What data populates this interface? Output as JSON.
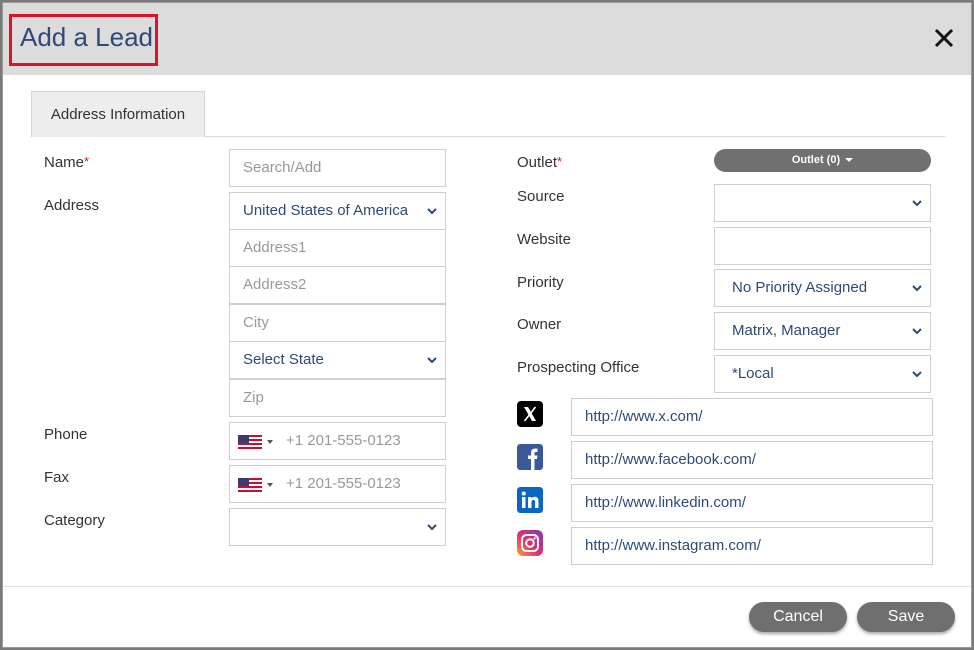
{
  "dialog": {
    "title": "Add a Lead",
    "close_label": "×"
  },
  "tabs": [
    {
      "label": "Address Information"
    }
  ],
  "left": {
    "name_label": "Name",
    "name_placeholder": "Search/Add",
    "address_label": "Address",
    "country_value": "United States of America",
    "address1_placeholder": "Address1",
    "address2_placeholder": "Address2",
    "city_placeholder": "City",
    "state_value": "Select State",
    "zip_placeholder": "Zip",
    "phone_label": "Phone",
    "phone_placeholder": "+1 201-555-0123",
    "fax_label": "Fax",
    "fax_placeholder": "+1 201-555-0123",
    "category_label": "Category",
    "category_value": ""
  },
  "right": {
    "outlet_label": "Outlet",
    "outlet_button": "Outlet (0)",
    "source_label": "Source",
    "source_value": "",
    "website_label": "Website",
    "website_value": "",
    "priority_label": "Priority",
    "priority_value": "No Priority Assigned",
    "owner_label": "Owner",
    "owner_value": "Matrix, Manager",
    "office_label": "Prospecting Office",
    "office_value": "*Local"
  },
  "social": [
    {
      "icon": "x-icon",
      "url": "http://www.x.com/"
    },
    {
      "icon": "facebook-icon",
      "url": "http://www.facebook.com/"
    },
    {
      "icon": "linkedin-icon",
      "url": "http://www.linkedin.com/"
    },
    {
      "icon": "instagram-icon",
      "url": "http://www.instagram.com/"
    }
  ],
  "required_marker": "*",
  "footer": {
    "cancel_label": "Cancel",
    "save_label": "Save"
  },
  "colors": {
    "accent": "#2d4a78",
    "highlight_border": "#e0102a",
    "button": "#6f6f6f"
  }
}
